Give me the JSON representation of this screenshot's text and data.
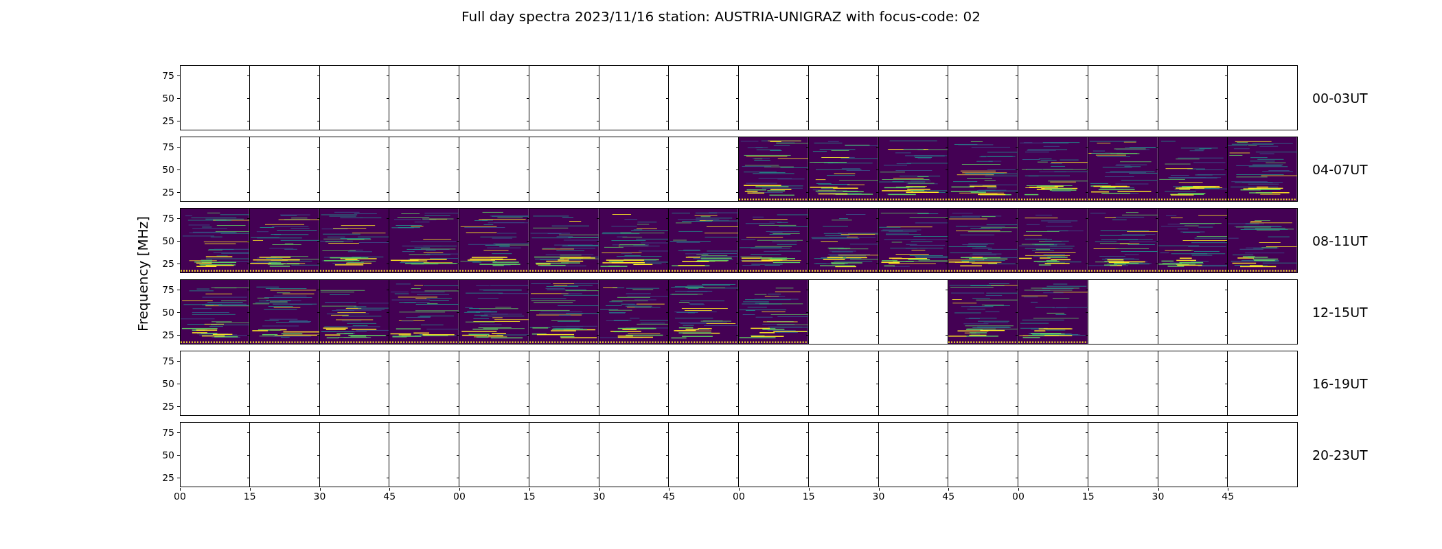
{
  "title": "Full day spectra 2023/11/16 station: AUSTRIA-UNIGRAZ with focus-code: 02",
  "ylabel": "Frequency [MHz]",
  "rows": [
    {
      "label": "00-03UT",
      "yticks": [
        "75",
        "50",
        "25"
      ],
      "panels": [
        {
          "has_data": false
        },
        {
          "has_data": false
        },
        {
          "has_data": false
        },
        {
          "has_data": false
        },
        {
          "has_data": false
        },
        {
          "has_data": false
        },
        {
          "has_data": false
        },
        {
          "has_data": false
        },
        {
          "has_data": false
        },
        {
          "has_data": false
        },
        {
          "has_data": false
        },
        {
          "has_data": false
        },
        {
          "has_data": false
        },
        {
          "has_data": false
        },
        {
          "has_data": false
        },
        {
          "has_data": false
        }
      ]
    },
    {
      "label": "04-07UT",
      "yticks": [
        "75",
        "50",
        "25"
      ],
      "panels": [
        {
          "has_data": false
        },
        {
          "has_data": false
        },
        {
          "has_data": false
        },
        {
          "has_data": false
        },
        {
          "has_data": false
        },
        {
          "has_data": false
        },
        {
          "has_data": false
        },
        {
          "has_data": false
        },
        {
          "has_data": true
        },
        {
          "has_data": true
        },
        {
          "has_data": true
        },
        {
          "has_data": true
        },
        {
          "has_data": true
        },
        {
          "has_data": true
        },
        {
          "has_data": true
        },
        {
          "has_data": true
        }
      ]
    },
    {
      "label": "08-11UT",
      "yticks": [
        "75",
        "50",
        "25"
      ],
      "panels": [
        {
          "has_data": true
        },
        {
          "has_data": true
        },
        {
          "has_data": true
        },
        {
          "has_data": true
        },
        {
          "has_data": true
        },
        {
          "has_data": true
        },
        {
          "has_data": true
        },
        {
          "has_data": true
        },
        {
          "has_data": true
        },
        {
          "has_data": true
        },
        {
          "has_data": true
        },
        {
          "has_data": true
        },
        {
          "has_data": true
        },
        {
          "has_data": true
        },
        {
          "has_data": true
        },
        {
          "has_data": true
        }
      ]
    },
    {
      "label": "12-15UT",
      "yticks": [
        "75",
        "50",
        "25"
      ],
      "panels": [
        {
          "has_data": true
        },
        {
          "has_data": true
        },
        {
          "has_data": true
        },
        {
          "has_data": true
        },
        {
          "has_data": true
        },
        {
          "has_data": true
        },
        {
          "has_data": true
        },
        {
          "has_data": true
        },
        {
          "has_data": true
        },
        {
          "has_data": false
        },
        {
          "has_data": false
        },
        {
          "has_data": true
        },
        {
          "has_data": true
        },
        {
          "has_data": false
        },
        {
          "has_data": false
        },
        {
          "has_data": false
        }
      ]
    },
    {
      "label": "16-19UT",
      "yticks": [
        "75",
        "50",
        "25"
      ],
      "panels": [
        {
          "has_data": false
        },
        {
          "has_data": false
        },
        {
          "has_data": false
        },
        {
          "has_data": false
        },
        {
          "has_data": false
        },
        {
          "has_data": false
        },
        {
          "has_data": false
        },
        {
          "has_data": false
        },
        {
          "has_data": false
        },
        {
          "has_data": false
        },
        {
          "has_data": false
        },
        {
          "has_data": false
        },
        {
          "has_data": false
        },
        {
          "has_data": false
        },
        {
          "has_data": false
        },
        {
          "has_data": false
        }
      ]
    },
    {
      "label": "20-23UT",
      "yticks": [
        "75",
        "50",
        "25"
      ],
      "panels": [
        {
          "has_data": false
        },
        {
          "has_data": false
        },
        {
          "has_data": false
        },
        {
          "has_data": false
        },
        {
          "has_data": false
        },
        {
          "has_data": false
        },
        {
          "has_data": false
        },
        {
          "has_data": false
        },
        {
          "has_data": false
        },
        {
          "has_data": false
        },
        {
          "has_data": false
        },
        {
          "has_data": false
        },
        {
          "has_data": false
        },
        {
          "has_data": false
        },
        {
          "has_data": false
        },
        {
          "has_data": false
        }
      ]
    }
  ],
  "xticks": [
    "00",
    "15",
    "30",
    "45",
    "00",
    "15",
    "30",
    "45",
    "00",
    "15",
    "30",
    "45",
    "00",
    "15",
    "30",
    "45"
  ]
}
